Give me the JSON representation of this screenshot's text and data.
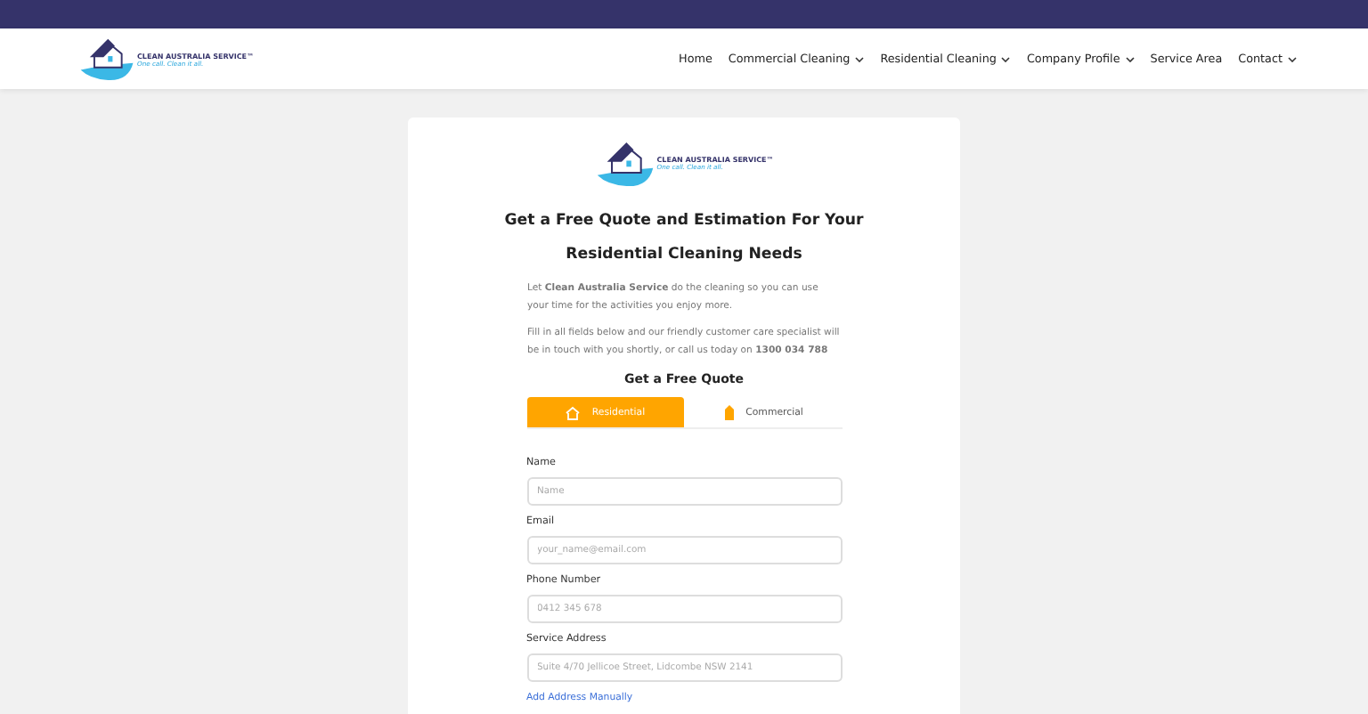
{
  "header": {
    "logo": {
      "name": "CLEAN AUSTRALIA SERVICE™",
      "tagline": "One call. Clean it all."
    },
    "nav": [
      {
        "label": "Home",
        "has_menu": false
      },
      {
        "label": "Commercial Cleaning",
        "has_menu": true
      },
      {
        "label": "Residential Cleaning",
        "has_menu": true
      },
      {
        "label": "Company Profile",
        "has_menu": true
      },
      {
        "label": "Service Area",
        "has_menu": false
      },
      {
        "label": "Contact",
        "has_menu": true
      }
    ]
  },
  "card": {
    "logo": {
      "name": "CLEAN AUSTRALIA SERVICE™",
      "tagline": "One call. Clean it all."
    },
    "title": "Get a Free Quote and Estimation For Your Residential Cleaning Needs",
    "paragraphs": [
      "Let **Clean Australia Service** do the cleaning so you can use your time for the activities you enjoy more.",
      "Fill in all fields below and our friendly customer care specialist will be in touch with you shortly, or call us today on **1300 034 788**"
    ],
    "form_title": "Get a Free Quote",
    "tabs": [
      {
        "label": "Residential",
        "kind": "house",
        "selected": true
      },
      {
        "label": "Commercial",
        "kind": "building",
        "selected": false
      }
    ],
    "fields": [
      {
        "label": "Name",
        "placeholder": "Name"
      },
      {
        "label": "Email",
        "placeholder": "your_name@email.com"
      },
      {
        "label": "Phone Number",
        "placeholder": "0412 345 678"
      },
      {
        "label": "Service Address",
        "placeholder": "Suite 4/70 Jellicoe Street, Lidcombe NSW 2141"
      }
    ],
    "link": "Add Address Manually"
  }
}
